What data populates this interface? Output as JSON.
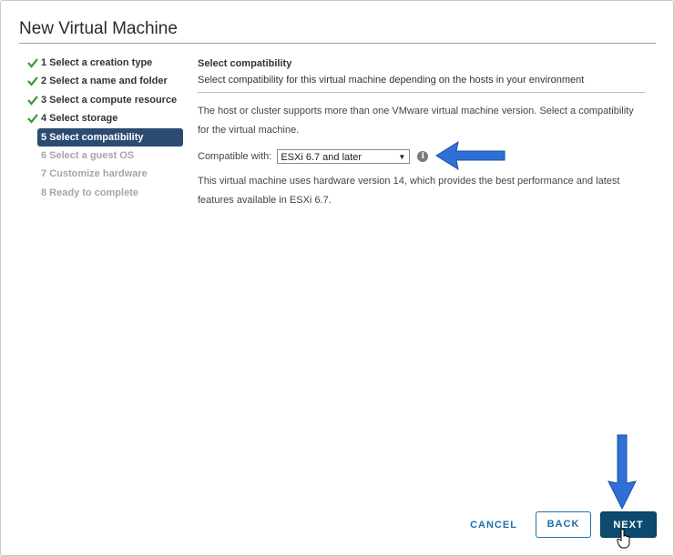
{
  "dialog": {
    "title": "New Virtual Machine"
  },
  "steps": [
    {
      "label": "1 Select a creation type",
      "state": "done"
    },
    {
      "label": "2 Select a name and folder",
      "state": "done"
    },
    {
      "label": "3 Select a compute resource",
      "state": "done"
    },
    {
      "label": "4 Select storage",
      "state": "done"
    },
    {
      "label": "5 Select compatibility",
      "state": "active"
    },
    {
      "label": "6 Select a guest OS",
      "state": "future"
    },
    {
      "label": "7 Customize hardware",
      "state": "future"
    },
    {
      "label": "8 Ready to complete",
      "state": "future"
    }
  ],
  "content": {
    "title": "Select compatibility",
    "subtitle": "Select compatibility for this virtual machine depending on the hosts in your environment",
    "description": "The host or cluster supports more than one VMware virtual machine version. Select a compatibility for the virtual machine.",
    "compatible_label": "Compatible with:",
    "compatible_value": "ESXi 6.7 and later",
    "info_glyph": "i",
    "hardware_note": "This virtual machine uses hardware version 14, which provides the best performance and latest features available in ESXi 6.7."
  },
  "footer": {
    "cancel": "CANCEL",
    "back": "BACK",
    "next": "NEXT"
  },
  "colors": {
    "active_step_bg": "#2c4b73",
    "check_green": "#3c9a3c",
    "link_blue": "#1f6fa8",
    "next_bg": "#0e4a6e",
    "annotation_arrow": "#2f6fd8"
  },
  "icons": {
    "done_step": "checkmark-icon",
    "info": "info-icon",
    "dropdown": "caret-down-icon",
    "pointer": "hand-cursor-icon"
  }
}
